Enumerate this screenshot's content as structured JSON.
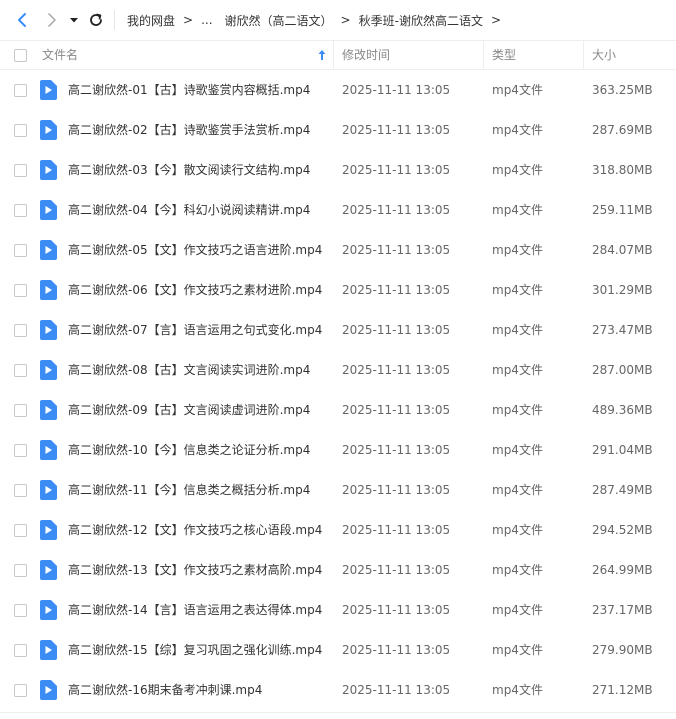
{
  "breadcrumb": {
    "items": [
      "我的网盘",
      "...",
      "谢欣然（高二语文）",
      "秋季班-谢欣然高二语文"
    ],
    "separator": ">"
  },
  "columns": {
    "name": "文件名",
    "modified": "修改时间",
    "type": "类型",
    "size": "大小"
  },
  "files": [
    {
      "name": "高二谢欣然-01【古】诗歌鉴赏内容概括.mp4",
      "modified": "2025-11-11 13:05",
      "type": "mp4文件",
      "size": "363.25MB"
    },
    {
      "name": "高二谢欣然-02【古】诗歌鉴赏手法赏析.mp4",
      "modified": "2025-11-11 13:05",
      "type": "mp4文件",
      "size": "287.69MB"
    },
    {
      "name": "高二谢欣然-03【今】散文阅读行文结构.mp4",
      "modified": "2025-11-11 13:05",
      "type": "mp4文件",
      "size": "318.80MB"
    },
    {
      "name": "高二谢欣然-04【今】科幻小说阅读精讲.mp4",
      "modified": "2025-11-11 13:05",
      "type": "mp4文件",
      "size": "259.11MB"
    },
    {
      "name": "高二谢欣然-05【文】作文技巧之语言进阶.mp4",
      "modified": "2025-11-11 13:05",
      "type": "mp4文件",
      "size": "284.07MB"
    },
    {
      "name": "高二谢欣然-06【文】作文技巧之素材进阶.mp4",
      "modified": "2025-11-11 13:05",
      "type": "mp4文件",
      "size": "301.29MB"
    },
    {
      "name": "高二谢欣然-07【言】语言运用之句式变化.mp4",
      "modified": "2025-11-11 13:05",
      "type": "mp4文件",
      "size": "273.47MB"
    },
    {
      "name": "高二谢欣然-08【古】文言阅读实词进阶.mp4",
      "modified": "2025-11-11 13:05",
      "type": "mp4文件",
      "size": "287.00MB"
    },
    {
      "name": "高二谢欣然-09【古】文言阅读虚词进阶.mp4",
      "modified": "2025-11-11 13:05",
      "type": "mp4文件",
      "size": "489.36MB"
    },
    {
      "name": "高二谢欣然-10【今】信息类之论证分析.mp4",
      "modified": "2025-11-11 13:05",
      "type": "mp4文件",
      "size": "291.04MB"
    },
    {
      "name": "高二谢欣然-11【今】信息类之概括分析.mp4",
      "modified": "2025-11-11 13:05",
      "type": "mp4文件",
      "size": "287.49MB"
    },
    {
      "name": "高二谢欣然-12【文】作文技巧之核心语段.mp4",
      "modified": "2025-11-11 13:05",
      "type": "mp4文件",
      "size": "294.52MB"
    },
    {
      "name": "高二谢欣然-13【文】作文技巧之素材高阶.mp4",
      "modified": "2025-11-11 13:05",
      "type": "mp4文件",
      "size": "264.99MB"
    },
    {
      "name": "高二谢欣然-14【言】语言运用之表达得体.mp4",
      "modified": "2025-11-11 13:05",
      "type": "mp4文件",
      "size": "237.17MB"
    },
    {
      "name": "高二谢欣然-15【综】复习巩固之强化训练.mp4",
      "modified": "2025-11-11 13:05",
      "type": "mp4文件",
      "size": "279.90MB"
    },
    {
      "name": "高二谢欣然-16期末备考冲刺课.mp4",
      "modified": "2025-11-11 13:05",
      "type": "mp4文件",
      "size": "271.12MB"
    }
  ],
  "icons": {
    "back": "back-arrow-icon",
    "forward": "forward-arrow-icon",
    "dropdown": "chevron-down-icon",
    "refresh": "refresh-icon",
    "sort": "sort-ascending-icon",
    "file": "video-file-icon"
  },
  "colors": {
    "accent": "#3b8cf5",
    "file_icon": "#3b8cf5",
    "header_text": "#888888",
    "divider": "#eeeeee"
  }
}
